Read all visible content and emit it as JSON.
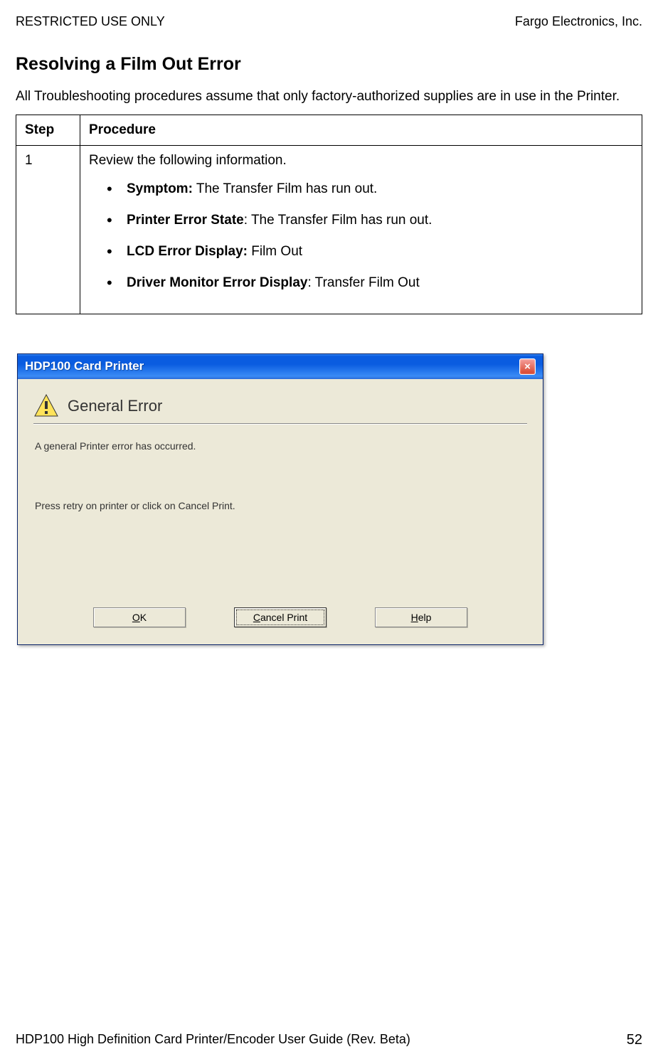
{
  "header": {
    "left": "RESTRICTED USE ONLY",
    "right": "Fargo Electronics, Inc."
  },
  "section": {
    "title": "Resolving a Film Out Error",
    "intro": "All Troubleshooting procedures assume that only factory-authorized supplies are in use in the Printer."
  },
  "table": {
    "headers": {
      "step": "Step",
      "procedure": "Procedure"
    },
    "rows": [
      {
        "step": "1",
        "intro": "Review the following information.",
        "items": [
          {
            "label": "Symptom:",
            "text": "  The Transfer Film has run out."
          },
          {
            "label": "Printer Error State",
            "text": ": The Transfer Film has run out."
          },
          {
            "label": "LCD Error Display:",
            "text": "  Film Out"
          },
          {
            "label": "Driver Monitor Error Display",
            "text": ":  Transfer Film Out"
          }
        ]
      }
    ]
  },
  "dialog": {
    "titlebar": "HDP100 Card Printer",
    "close": "×",
    "heading": "General Error",
    "message": "A general Printer error has occurred.",
    "instruction": "Press retry on printer or click on Cancel Print.",
    "buttons": {
      "ok_u": "O",
      "ok_rest": "K",
      "cancel_u": "C",
      "cancel_rest": "ancel Print",
      "help_u": "H",
      "help_rest": "elp"
    }
  },
  "footer": {
    "left": "HDP100 High Definition Card Printer/Encoder User Guide (Rev. Beta)",
    "page": "52"
  }
}
